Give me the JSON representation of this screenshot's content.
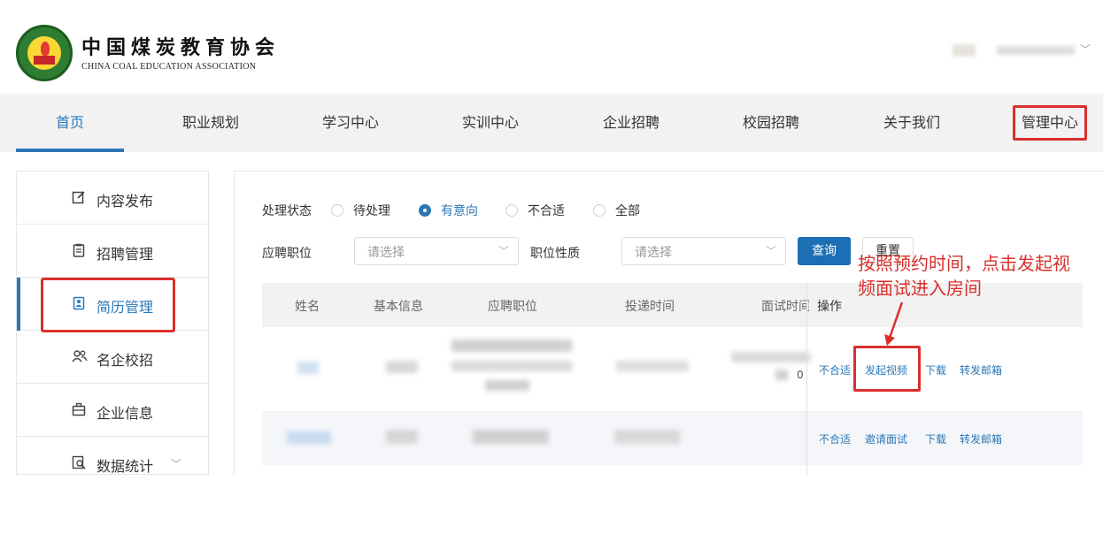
{
  "header": {
    "org_name": "中国煤炭教育协会",
    "org_name_en": "CHINA COAL EDUCATION ASSOCIATION",
    "logo_icon": "coal-education-association-seal",
    "user_menu_icon": "chevron-down-icon"
  },
  "nav": {
    "items": [
      {
        "label": "首页",
        "active": true
      },
      {
        "label": "职业规划"
      },
      {
        "label": "学习中心"
      },
      {
        "label": "实训中心"
      },
      {
        "label": "企业招聘"
      },
      {
        "label": "校园招聘"
      },
      {
        "label": "关于我们"
      },
      {
        "label": "管理中心",
        "highlighted": true
      }
    ]
  },
  "sidebar": {
    "items": [
      {
        "label": "内容发布",
        "icon": "edit-icon"
      },
      {
        "label": "招聘管理",
        "icon": "clipboard-icon"
      },
      {
        "label": "简历管理",
        "icon": "resume-icon",
        "active": true,
        "highlighted": true
      },
      {
        "label": "名企校招",
        "icon": "users-icon"
      },
      {
        "label": "企业信息",
        "icon": "briefcase-icon"
      },
      {
        "label": "数据统计",
        "icon": "report-search-icon",
        "has_dropdown": true
      }
    ]
  },
  "filters": {
    "status_label": "处理状态",
    "status_options": [
      {
        "label": "待处理",
        "checked": false
      },
      {
        "label": "有意向",
        "checked": true
      },
      {
        "label": "不合适",
        "checked": false
      },
      {
        "label": "全部",
        "checked": false
      }
    ],
    "position_label": "应聘职位",
    "position_placeholder": "请选择",
    "nature_label": "职位性质",
    "nature_placeholder": "请选择",
    "query_button": "查询",
    "reset_button": "重置"
  },
  "table": {
    "columns": [
      "姓名",
      "基本信息",
      "应聘职位",
      "投递时间",
      "面试时间",
      "操作"
    ],
    "rows": [
      {
        "interview_time_partial": "0",
        "actions": [
          "不合适",
          "发起视频",
          "下载",
          "转发邮箱"
        ]
      },
      {
        "actions": [
          "不合适",
          "邀请面试",
          "下载",
          "转发邮箱"
        ]
      }
    ]
  },
  "annotation": {
    "text_line1": "按照预约时间，点击发起视",
    "text_line2": "频面试进入房间",
    "color": "#d9302c"
  },
  "colors": {
    "accent": "#2a78b8",
    "button": "#1c6eb5",
    "highlight": "#d9302c",
    "nav_bg": "#f2f2f2"
  }
}
